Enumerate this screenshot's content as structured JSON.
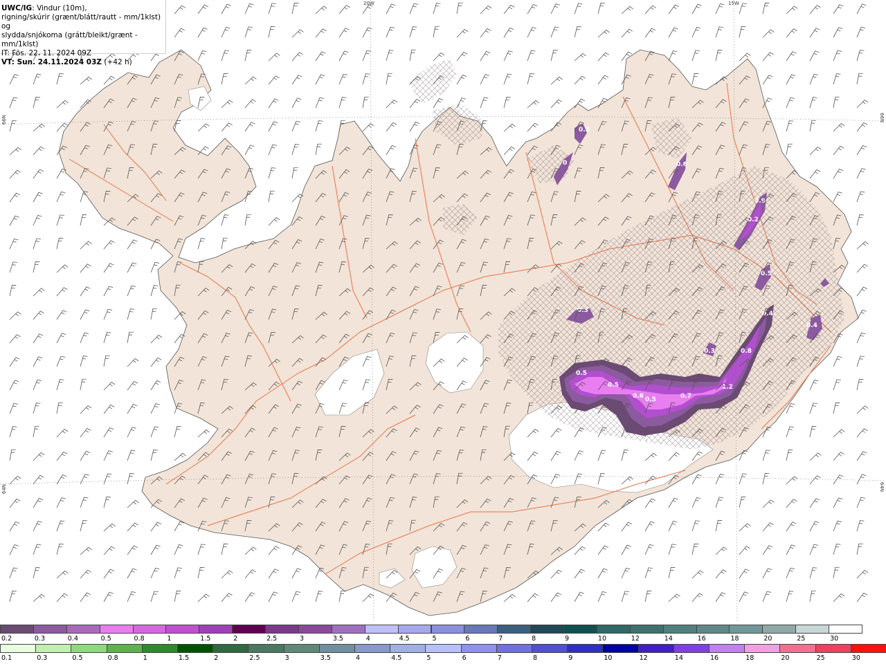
{
  "title": {
    "product": "UWC/IG",
    "line1_rest": ": Vindur (10m),",
    "line2": "rigning/skúrir (grænt/blátt/rautt - mm/1klst) og",
    "line3": "slydda/snjókoma (grátt/bleikt/grænt - mm/1klst)",
    "issue_time": "IT: Fös. 22. 11. 2024 09Z",
    "valid_prefix": "VT: Sun. 24.11.2024 03Z",
    "valid_suffix": " (+42 h)"
  },
  "grid_labels": {
    "lon_20w": "20W",
    "lon_15w": "15W",
    "lat_66n_left": "66N",
    "lat_66n_right": "66N",
    "lat_64n_left": "64N",
    "lat_64n_right": "64N"
  },
  "precip_labels": [
    "0.3",
    "0",
    "0.6",
    "0.9",
    "0.2",
    "0.5",
    "0.3",
    "0.4",
    "0.4",
    "0.3",
    "0.8",
    "0.5",
    "0.5",
    "0.6",
    "0.5",
    "0.7",
    "1.2"
  ],
  "colors": {
    "land": "#f2e4d8",
    "roads": "#e8734a",
    "glacier": "#ffffff",
    "wind_barb": "#555555",
    "precip_light": "#8c5a9e",
    "precip_mid": "#b24fcf",
    "precip_high": "#e87ef0"
  },
  "legend_snow": {
    "labels": [
      "0.2",
      "0.3",
      "0.4",
      "0.5",
      "0.8",
      "1",
      "1.5",
      "2",
      "2.5",
      "3",
      "3.5",
      "4",
      "4.5",
      "5",
      "6",
      "7",
      "8",
      "9",
      "10",
      "12",
      "14",
      "16",
      "18",
      "20",
      "25",
      "30"
    ],
    "colors": [
      "#6b4a73",
      "#8c5a9e",
      "#a86ab8",
      "#e87ef0",
      "#d468e0",
      "#c050d0",
      "#a040b8",
      "#600050",
      "#7a3a88",
      "#8a4a9a",
      "#a070c0",
      "#c0c0f8",
      "#a8a8ec",
      "#8a90dc",
      "#6878b8",
      "#3a6080",
      "#204858",
      "#105050",
      "#306868",
      "#407070",
      "#508080",
      "#608888",
      "#709898",
      "#90a8a8",
      "#c8d8d8",
      "#ffffff"
    ]
  },
  "legend_rain": {
    "labels": [
      "0.1",
      "0.3",
      "0.5",
      "0.8",
      "1",
      "1.5",
      "2",
      "2.5",
      "3",
      "3.5",
      "4",
      "4.5",
      "5",
      "6",
      "7",
      "8",
      "9",
      "10",
      "12",
      "14",
      "16",
      "18",
      "20",
      "25",
      "30"
    ],
    "colors": [
      "#e8ffe0",
      "#c0f0b0",
      "#90d880",
      "#60b050",
      "#308830",
      "#005000",
      "#306840",
      "#4a7860",
      "#608878",
      "#7090a0",
      "#8898c8",
      "#a0b0e0",
      "#b8c0f8",
      "#9090f0",
      "#7070e0",
      "#5050d0",
      "#3030c0",
      "#0000a0",
      "#4020c0",
      "#8040e0",
      "#c080f0",
      "#f0a0e0",
      "#f07090",
      "#f04060",
      "#ff1010"
    ]
  }
}
